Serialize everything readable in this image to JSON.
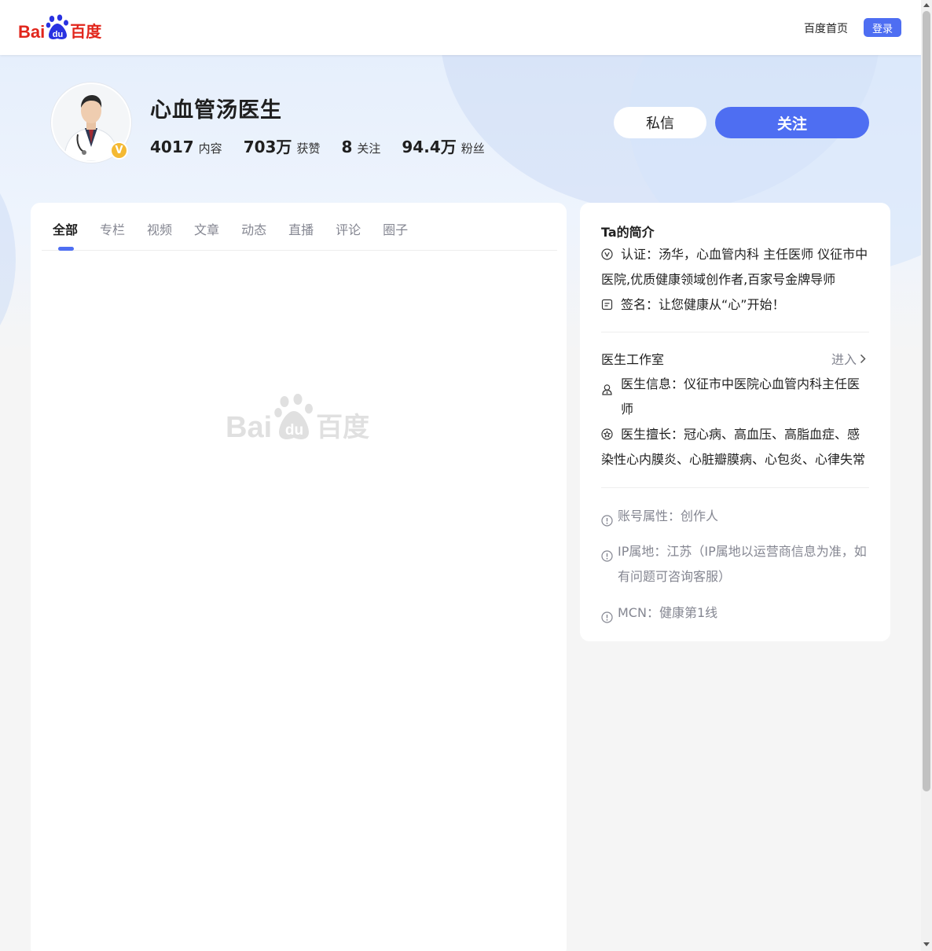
{
  "header": {
    "logo_bai": "Bai",
    "logo_du": "du",
    "logo_cn": "百度",
    "home_link": "百度首页",
    "login_label": "登录",
    "accent_color": "#4e6ef2",
    "logo_color": "#e1251b"
  },
  "profile": {
    "name": "心血管汤医生",
    "verify_mark": "V",
    "stats": [
      {
        "value": "4017",
        "label": "内容"
      },
      {
        "value": "703万",
        "label": "获赞"
      },
      {
        "value": "8",
        "label": "关注"
      },
      {
        "value": "94.4万",
        "label": "粉丝"
      }
    ],
    "message_label": "私信",
    "follow_label": "关注"
  },
  "tabs": [
    "全部",
    "专栏",
    "视频",
    "文章",
    "动态",
    "直播",
    "评论",
    "圈子"
  ],
  "active_tab": "全部",
  "placeholder": {
    "logo_bai": "Bai",
    "logo_du": "du",
    "logo_cn": "百度"
  },
  "intro": {
    "title": "Ta的简介",
    "certification": "认证：汤华，心血管内科 主任医师 仪征市中医院,优质健康领域创作者,百家号金牌导师",
    "signature": "签名：让您健康从“心”开始！"
  },
  "studio": {
    "title": "医生工作室",
    "enter_label": "进入",
    "doctor_info": "医生信息：仪征市中医院心血管内科主任医师",
    "specialty": "医生擅长：冠心病、高血压、高脂血症、感染性心内膜炎、心脏瓣膜病、心包炎、心律失常"
  },
  "meta": {
    "account_type": "账号属性：创作人",
    "ip_location": "IP属地：江苏（IP属地以运营商信息为准，如有问题可咨询客服）",
    "mcn": "MCN：健康第1线"
  }
}
